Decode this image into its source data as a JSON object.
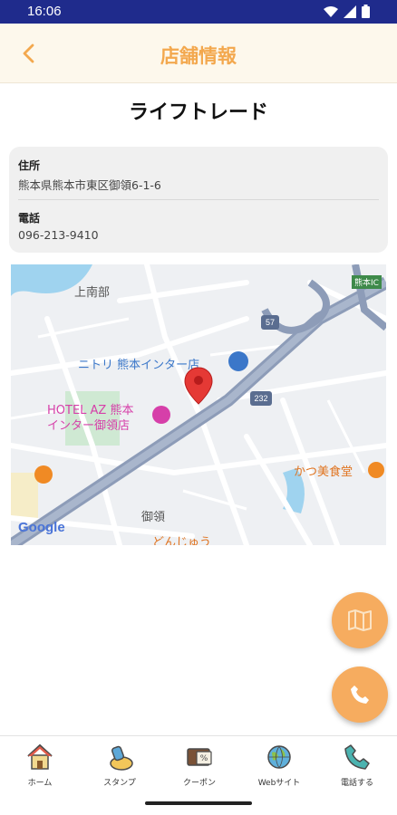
{
  "status_bar": {
    "time": "16:06"
  },
  "header": {
    "title": "店舗情報",
    "back_icon": "chevron-left-icon"
  },
  "store": {
    "name": "ライフトレード"
  },
  "info": {
    "address_label": "住所",
    "address_value": "熊本県熊本市東区御領6-1-6",
    "phone_label": "電話",
    "phone_value": "096-213-9410"
  },
  "map": {
    "labels": {
      "kaminanbe": "上南部",
      "nitori": "ニトリ 熊本インター店",
      "hotel_line1": "HOTEL AZ 熊本",
      "hotel_line2": "インター御領店",
      "katsumi": "かつ美食堂",
      "goryo": "御領",
      "donjuu": "どんじゅう",
      "route57": "57",
      "route232": "232",
      "kumamoto_ic": "熊本IC",
      "google": "Google"
    },
    "colors": {
      "highway": "#8d9cb8",
      "road": "#ffffff",
      "pin": "#e53935",
      "park": "#cfe9d3",
      "water": "#9fd3ef"
    }
  },
  "fabs": {
    "map_icon": "map-icon",
    "phone_icon": "phone-icon"
  },
  "bottom_nav": {
    "items": [
      {
        "label": "ホーム",
        "icon": "home-icon"
      },
      {
        "label": "スタンプ",
        "icon": "stamp-icon"
      },
      {
        "label": "クーポン",
        "icon": "coupon-icon"
      },
      {
        "label": "Webサイト",
        "icon": "globe-icon"
      },
      {
        "label": "電話する",
        "icon": "phone-icon"
      }
    ]
  },
  "colors": {
    "accent": "#f3a84e",
    "status_bar": "#1f2b8c",
    "header_bg": "#fdf8ec",
    "fab": "#f6ac5f"
  }
}
